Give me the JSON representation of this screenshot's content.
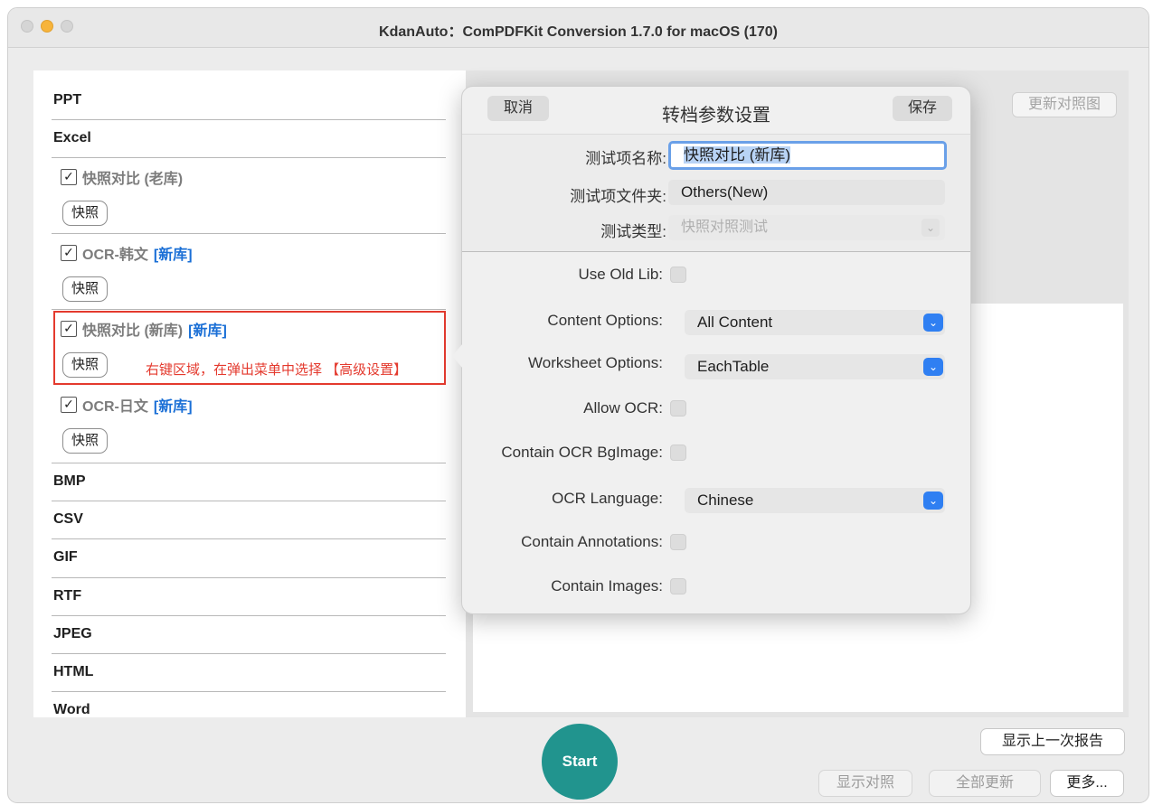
{
  "window": {
    "title": "KdanAuto：ComPDFKit Conversion 1.7.0 for macOS (170)"
  },
  "sidebar": {
    "categories_top": [
      "PPT",
      "Excel"
    ],
    "items": [
      {
        "label": "快照对比 (老库)",
        "tag": "",
        "snapshot": "快照"
      },
      {
        "label": "OCR-韩文",
        "tag": "[新库]",
        "snapshot": "快照"
      },
      {
        "label": "快照对比 (新库)",
        "tag": "[新库]",
        "snapshot": "快照"
      },
      {
        "label": "OCR-日文",
        "tag": "[新库]",
        "snapshot": "快照"
      }
    ],
    "check_glyph": "✓",
    "categories_bottom": [
      "BMP",
      "CSV",
      "GIF",
      "RTF",
      "JPEG",
      "HTML",
      "Word"
    ],
    "hint": "右键区域，在弹出菜单中选择 【高级设置】"
  },
  "right_panel": {
    "refresh_image_button": "更新对照图"
  },
  "popover": {
    "cancel": "取消",
    "title": "转档参数设置",
    "save": "保存",
    "test_name_label": "测试项名称:",
    "test_name_value": "快照对比 (新库)",
    "test_folder_label": "测试项文件夹:",
    "test_folder_value": "Others(New)",
    "test_type_label": "测试类型:",
    "test_type_value": "快照对照测试",
    "options": {
      "use_old_lib": "Use Old Lib:",
      "content_options": "Content Options:",
      "content_options_value": "All Content",
      "worksheet_options": "Worksheet Options:",
      "worksheet_options_value": "EachTable",
      "allow_ocr": "Allow OCR:",
      "contain_ocr_bgimage": "Contain OCR BgImage:",
      "ocr_language": "OCR Language:",
      "ocr_language_value": "Chinese",
      "contain_annotations": "Contain Annotations:",
      "contain_images": "Contain Images:"
    }
  },
  "bottom": {
    "start": "Start",
    "show_last_report": "显示上一次报告",
    "show_compare": "显示对照",
    "update_all": "全部更新",
    "more": "更多..."
  },
  "colors": {
    "accent_blue": "#2f7ff2",
    "start_teal": "#21948e",
    "annotation_red": "#e43a2e",
    "tag_blue": "#1a6fd6"
  }
}
